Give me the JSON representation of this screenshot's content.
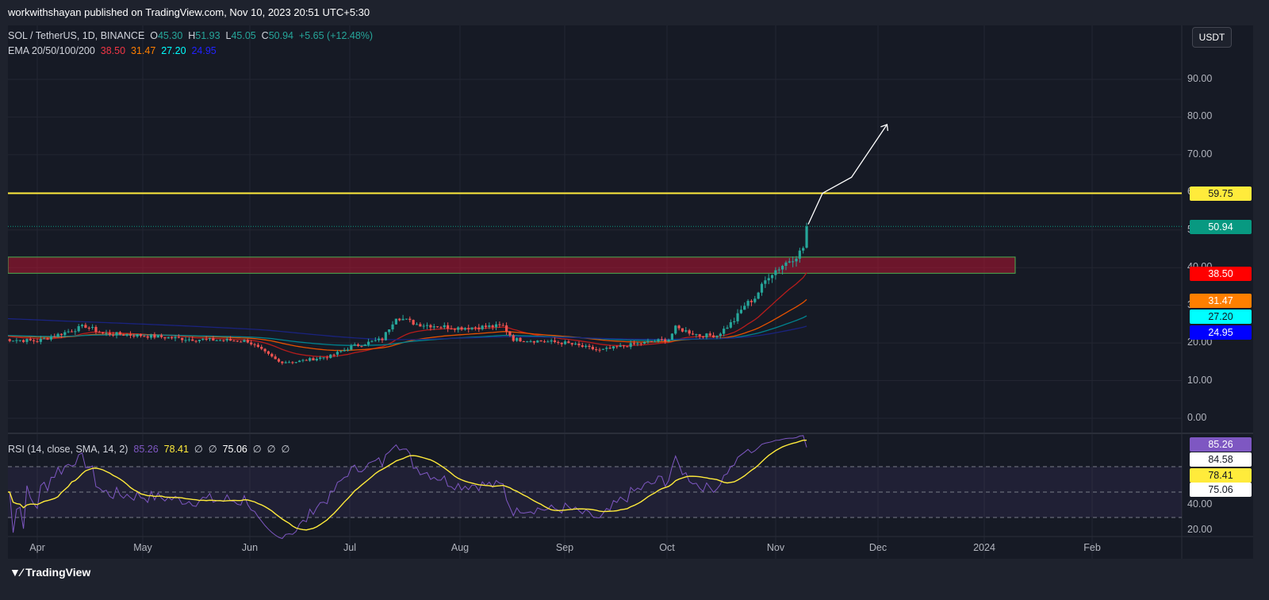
{
  "header": {
    "publisher": "workwithshayan published on TradingView.com, Nov 10, 2023 20:51 UTC+5:30"
  },
  "legend": {
    "symbol": "SOL / TetherUS, 1D, BINANCE",
    "o_label": "O",
    "open": "45.30",
    "h_label": "H",
    "high": "51.93",
    "l_label": "L",
    "low": "45.05",
    "c_label": "C",
    "close": "50.94",
    "change": "+5.65 (+12.48%)",
    "ema_label": "EMA 20/50/100/200",
    "ema20": "38.50",
    "ema50": "31.47",
    "ema100": "27.20",
    "ema200": "24.95"
  },
  "rsi_legend": {
    "label": "RSI (14, close, SMA, 14, 2)",
    "rsi": "85.26",
    "sma": "78.41",
    "n1": "∅",
    "n2": "∅",
    "bb": "75.06",
    "n3": "∅",
    "n4": "∅",
    "n5": "∅"
  },
  "currency": "USDT",
  "price_axis": [
    "90.00",
    "80.00",
    "70.00",
    "60.00",
    "50.00",
    "40.00",
    "30.00",
    "20.00",
    "10.00",
    "0.00"
  ],
  "rsi_axis": [
    "40.00",
    "20.00"
  ],
  "price_labels": {
    "resistance": "59.75",
    "last": "50.94",
    "ema20": "38.50",
    "ema50": "31.47",
    "ema100": "27.20",
    "ema200": "24.95"
  },
  "rsi_labels": {
    "rsi": "85.26",
    "upper": "84.58",
    "sma": "78.41",
    "lower": "75.06"
  },
  "months": [
    "Apr",
    "May",
    "Jun",
    "Jul",
    "Aug",
    "Sep",
    "Oct",
    "Nov",
    "Dec",
    "2024",
    "Feb"
  ],
  "footer": {
    "brand": "TradingView"
  },
  "colors": {
    "up": "#26a69a",
    "down": "#ef5350",
    "ema20": "#ff0000",
    "ema50": "#ff7f00",
    "ema100": "#00ffff",
    "ema200": "#0000ff",
    "rsi": "#7e57c2",
    "rsi_sma": "#ffeb3b",
    "resistance": "#ffeb3b"
  },
  "chart_data": {
    "type": "candlestick",
    "symbol": "SOLUSDT",
    "start": "2023-03-22",
    "close_waypoints": [
      [
        0,
        21
      ],
      [
        10,
        20.5
      ],
      [
        24,
        24.5
      ],
      [
        29,
        22.5
      ],
      [
        40,
        22
      ],
      [
        54,
        21
      ],
      [
        71,
        20.5
      ],
      [
        75,
        18
      ],
      [
        80,
        15
      ],
      [
        85,
        15
      ],
      [
        95,
        16.5
      ],
      [
        101,
        19
      ],
      [
        110,
        21
      ],
      [
        114,
        27
      ],
      [
        120,
        25
      ],
      [
        132,
        24
      ],
      [
        145,
        24.5
      ],
      [
        148,
        21
      ],
      [
        163,
        20
      ],
      [
        173,
        18
      ],
      [
        182,
        19.5
      ],
      [
        193,
        21
      ],
      [
        195,
        24
      ],
      [
        202,
        22
      ],
      [
        207,
        22
      ],
      [
        212,
        26
      ],
      [
        215,
        30
      ],
      [
        218,
        32
      ],
      [
        222,
        38
      ],
      [
        225,
        40
      ],
      [
        231,
        44
      ],
      [
        232,
        45.3
      ],
      [
        233,
        50.94
      ]
    ],
    "last_bar": {
      "open": 45.3,
      "high": 51.93,
      "low": 45.05,
      "close": 50.94
    },
    "resistance": 59.75,
    "zone": [
      38.5,
      42.8
    ],
    "projection": [
      [
        233,
        59.75
      ],
      [
        246,
        64
      ],
      [
        254,
        78
      ]
    ]
  }
}
